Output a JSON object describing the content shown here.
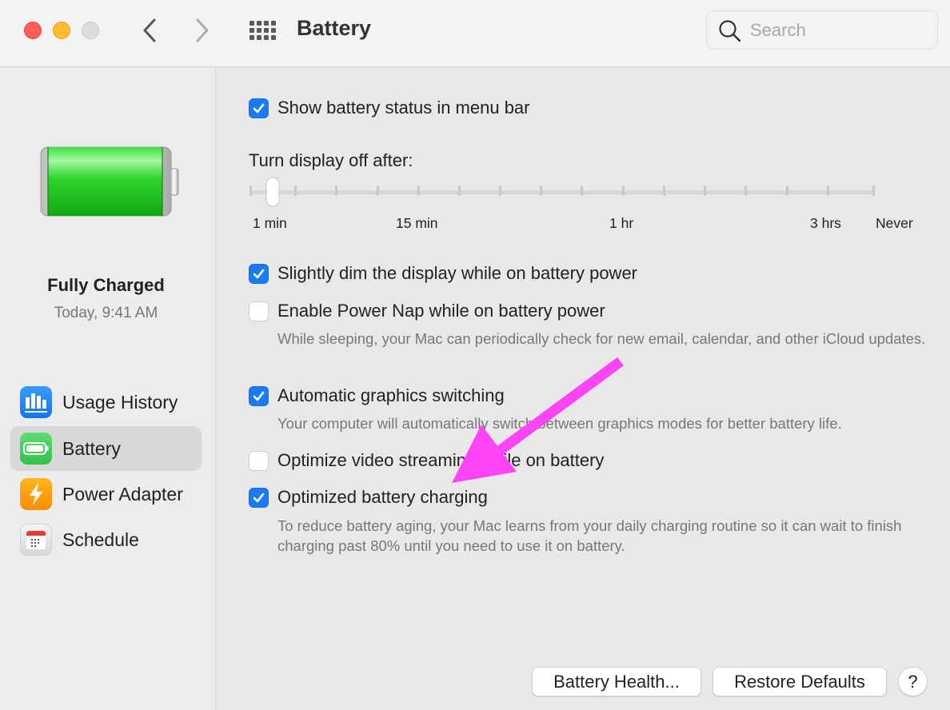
{
  "window": {
    "title": "Battery",
    "search_placeholder": "Search",
    "search_value": ""
  },
  "sidebar": {
    "status_title": "Fully Charged",
    "status_time": "Today, 9:41 AM",
    "battery_level_percent": 100,
    "items": [
      {
        "label": "Usage History",
        "icon": "bar-chart-icon",
        "selected": false
      },
      {
        "label": "Battery",
        "icon": "battery-icon",
        "selected": true
      },
      {
        "label": "Power Adapter",
        "icon": "lightning-icon",
        "selected": false
      },
      {
        "label": "Schedule",
        "icon": "calendar-icon",
        "selected": false
      }
    ]
  },
  "settings": {
    "show_status": {
      "label": "Show battery status in menu bar",
      "checked": true
    },
    "display_off": {
      "label": "Turn display off after:",
      "tick_count": 16,
      "selected_index": 1,
      "tick_labels": [
        "1 min",
        "15 min",
        "1 hr",
        "3 hrs",
        "Never"
      ]
    },
    "dim_display": {
      "label": "Slightly dim the display while on battery power",
      "checked": true
    },
    "power_nap": {
      "label": "Enable Power Nap while on battery power",
      "checked": false,
      "description": "While sleeping, your Mac can periodically check for new email, calendar, and other iCloud updates."
    },
    "graphics_switching": {
      "label": "Automatic graphics switching",
      "checked": true,
      "description": "Your computer will automatically switch between graphics modes for better battery life."
    },
    "video_streaming": {
      "label": "Optimize video streaming while on battery",
      "checked": false
    },
    "optimized_charging": {
      "label": "Optimized battery charging",
      "checked": true,
      "description": "To reduce battery aging, your Mac learns from your daily charging routine so it can wait to finish charging past 80% until you need to use it on battery."
    }
  },
  "buttons": {
    "battery_health": "Battery Health...",
    "restore_defaults": "Restore Defaults",
    "help": "?"
  },
  "colors": {
    "accent": "#1a7cf5",
    "annotation_arrow": "#ff44f6",
    "battery_green": "#2ed12e"
  }
}
